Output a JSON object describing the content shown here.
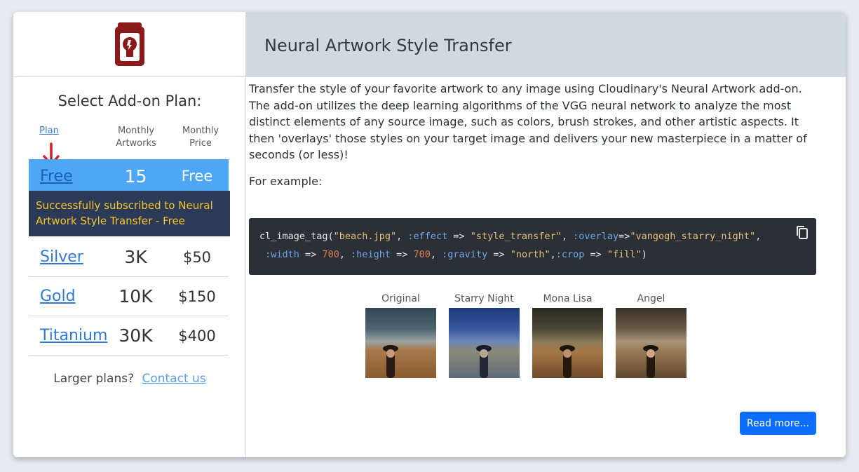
{
  "sidebar": {
    "select_title": "Select Add-on Plan:",
    "columns": {
      "plan": "Plan",
      "artworks": "Monthly\nArtworks",
      "price": "Monthly\nPrice"
    },
    "plans": [
      {
        "name": "Free",
        "artworks": "15",
        "price": "Free",
        "active": true
      },
      {
        "name": "Silver",
        "artworks": "3K",
        "price": "$50"
      },
      {
        "name": "Gold",
        "artworks": "10K",
        "price": "$150"
      },
      {
        "name": "Titanium",
        "artworks": "30K",
        "price": "$400"
      }
    ],
    "toast": "Successfully subscribed to Neural Artwork Style Transfer - Free",
    "larger_plans": "Larger plans?",
    "contact_link": "Contact us"
  },
  "header": {
    "title": "Neural Artwork Style Transfer"
  },
  "main": {
    "description": "Transfer the style of your favorite artwork to any image using Cloudinary's Neural Artwork add-on. The add-on utilizes the deep learning algorithms of the VGG neural network to analyze the most distinct elements of any source image, such as colors, brush strokes, and other artistic aspects. It then 'overlays' those styles on your target image and delivers your new masterpiece in a matter of seconds (or less)!",
    "example_label": "For example:",
    "code": {
      "fn": "cl_image_tag(",
      "arg1": "\"beach.jpg\"",
      "effect_key": ":effect",
      "effect_val": "\"style_transfer\"",
      "overlay_key": ":overlay",
      "overlay_val": "\"vangogh_starry_night\"",
      "width_key": ":width",
      "width_val": "700",
      "height_key": ":height",
      "height_val": "700",
      "gravity_key": ":gravity",
      "gravity_val": "\"north\"",
      "crop_key": ":crop",
      "crop_val": "\"fill\""
    },
    "gallery": [
      {
        "label": "Original"
      },
      {
        "label": "Starry Night"
      },
      {
        "label": "Mona Lisa"
      },
      {
        "label": "Angel"
      }
    ],
    "read_more": "Read more..."
  },
  "colors": {
    "accent": "#0d6efd",
    "active_row": "#4ea6f7",
    "toast_bg": "#2b3a57",
    "toast_text": "#f6c431",
    "logo": "#8b1a1a"
  }
}
